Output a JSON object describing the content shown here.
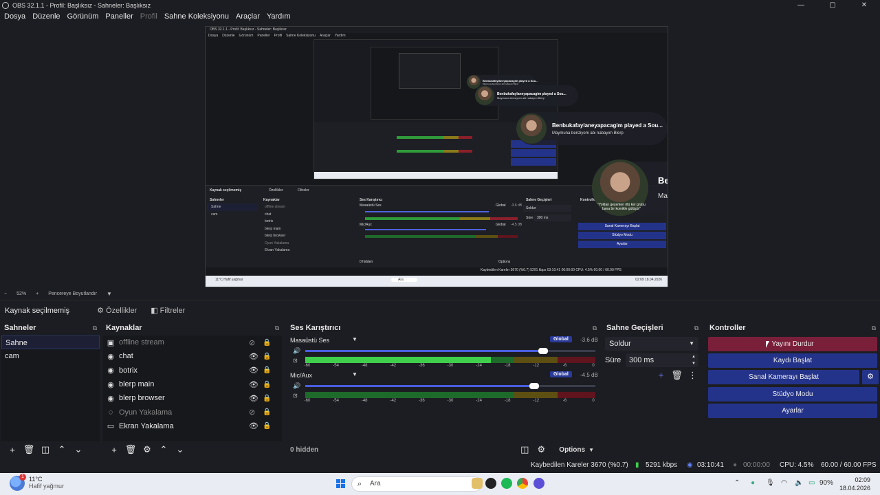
{
  "window": {
    "title": "OBS 32.1.1 - Profil: Başlıksız - Sahneler: Başlıksız",
    "controls": [
      "—",
      "▢",
      "✕"
    ]
  },
  "menu": [
    {
      "label": "Dosya",
      "enabled": true
    },
    {
      "label": "Düzenle",
      "enabled": true
    },
    {
      "label": "Görünüm",
      "enabled": true
    },
    {
      "label": "Paneller",
      "enabled": true
    },
    {
      "label": "Profil",
      "enabled": false
    },
    {
      "label": "Sahne Koleksiyonu",
      "enabled": true
    },
    {
      "label": "Araçlar",
      "enabled": true
    },
    {
      "label": "Yardım",
      "enabled": true
    }
  ],
  "preview": {
    "mini_title": "OBS 32.1.1 - Profil: Başlıksız - Sahneler: Başlıksız",
    "mini_menu": [
      "Dosya",
      "Düzenle",
      "Görünüm",
      "Paneller",
      "Profil",
      "Sahne Koleksiyonu",
      "Araçlar",
      "Yardım"
    ],
    "notifications": [
      {
        "title": "Benbukafaylaneyapacagim played a Sou...",
        "subtitle": "Maymuna benziyom abi nabayım Blerp"
      },
      {
        "title": "Benbukafaylaneyapacagim played a Sou...",
        "subtitle": "Maymuna benziyom abi nabayım Blerp"
      },
      {
        "title": "Benbukafaylaneyapacagim played a Sou...",
        "subtitle": "Maymuna benziyom abi nabayım Blerp"
      },
      {
        "title": "Benbukafaylaneyapacagim played a Sou...",
        "subtitle": "Maymuna benziyom abi nabayım Blerp"
      }
    ],
    "avatar_caption": "\"Yoldan geçerken ritü ker grubu bana bir komikle gülüşür\"",
    "mini_docks": {
      "status": "Kaynak seçilmemiş",
      "props": "Özellikler",
      "filters": "Filtreler",
      "scenes_title": "Sahneler",
      "scenes": [
        "Sahne",
        "cam"
      ],
      "sources_title": "Kaynaklar",
      "sources": [
        "offline stream",
        "chat",
        "botrix",
        "blerp main",
        "blerp browser",
        "Oyun Yakalama",
        "Ekran Yakalama"
      ],
      "mixer_title": "Ses Karıştırıcı",
      "mixer_ch1": "Masaüstü Ses",
      "mixer_ch1_db": "-3.6 dB",
      "mixer_ch2": "Mic/Aux",
      "mixer_ch2_db": "-4.5 dB",
      "global": "Global",
      "hidden": "0 hidden",
      "options": "Options",
      "trans_title": "Sahne Geçişleri",
      "trans": "Soldur",
      "dur_lbl": "Süre",
      "dur": "300 ms",
      "ctrl_title": "Kontroller",
      "ctrl_btns": [
        "Sanal Kamerayı Başlat",
        "Stüdyo Modu",
        "Ayarlar"
      ],
      "status_line": "Kaybedilen Kareler 3670 (%0.7)   5291 kbps   03:10:41   00:00:00   CPU: 4.5%   60.00 / 60.00 FPS",
      "weather": "11°C Hafif yağmur",
      "search": "Ara",
      "clock": "02:09 18.04.2026"
    }
  },
  "zoom": {
    "minus": "−",
    "value": "52%",
    "plus": "+",
    "resize": "Pencereye Boyutlandır"
  },
  "source_toolbar": {
    "status": "Kaynak seçilmemiş",
    "properties": "Özellikler",
    "filters": "Filtreler"
  },
  "scenes": {
    "title": "Sahneler",
    "items": [
      "Sahne",
      "cam"
    ]
  },
  "sources": {
    "title": "Kaynaklar",
    "items": [
      {
        "name": "offline stream",
        "icon": "image-icon",
        "glyph": "▣",
        "visible": false
      },
      {
        "name": "chat",
        "icon": "browser-icon",
        "glyph": "◉",
        "visible": true
      },
      {
        "name": "botrix",
        "icon": "browser-icon",
        "glyph": "◉",
        "visible": true
      },
      {
        "name": "blerp main",
        "icon": "browser-icon",
        "glyph": "◉",
        "visible": true
      },
      {
        "name": "blerp browser",
        "icon": "browser-icon",
        "glyph": "◉",
        "visible": true
      },
      {
        "name": "Oyun Yakalama",
        "icon": "gamepad-icon",
        "glyph": "◌",
        "visible": false
      },
      {
        "name": "Ekran Yakalama",
        "icon": "monitor-icon",
        "glyph": "▭",
        "visible": true
      }
    ]
  },
  "mixer": {
    "title": "Ses Karıştırıcı",
    "channels": [
      {
        "name": "Masaüstü Ses",
        "badge": "Global",
        "db": "-3.6 dB",
        "volume": 0.82,
        "level": 0.64
      },
      {
        "name": "Mic/Aux",
        "badge": "Global",
        "db": "-4.5 dB",
        "volume": 0.79,
        "level": 0.0
      }
    ],
    "ticks": [
      "-60",
      "-54",
      "-48",
      "-42",
      "-36",
      "-30",
      "-24",
      "-18",
      "-12",
      "-6",
      "0"
    ],
    "hidden": "0 hidden",
    "options": "Options"
  },
  "transitions": {
    "title": "Sahne Geçişleri",
    "type": "Soldur",
    "duration_label": "Süre",
    "duration": "300 ms"
  },
  "controls": {
    "title": "Kontroller",
    "buttons": [
      "Yayını Durdur",
      "Kaydı Başlat",
      "Sanal Kamerayı Başlat",
      "Stüdyo Modu",
      "Ayarlar"
    ]
  },
  "status": {
    "dropped": "Kaybedilen Kareler 3670 (%0.7)",
    "bitrate": "5291 kbps",
    "stream_time": "03:10:41",
    "rec_time": "00:00:00",
    "cpu": "CPU: 4.5%",
    "fps": "60.00 / 60.00 FPS"
  },
  "taskbar": {
    "weather_badge": "1",
    "temp": "11°C",
    "condition": "Hafif yağmur",
    "search_placeholder": "Ara",
    "battery": "90%",
    "time": "02:09",
    "date": "18.04.2026"
  },
  "colors": {
    "accent": "#24338a",
    "stop": "#7a1f3a",
    "meter_green": "#3fcf4c",
    "meter_yellow": "#8a7a1a",
    "meter_red": "#8b1f2b"
  }
}
